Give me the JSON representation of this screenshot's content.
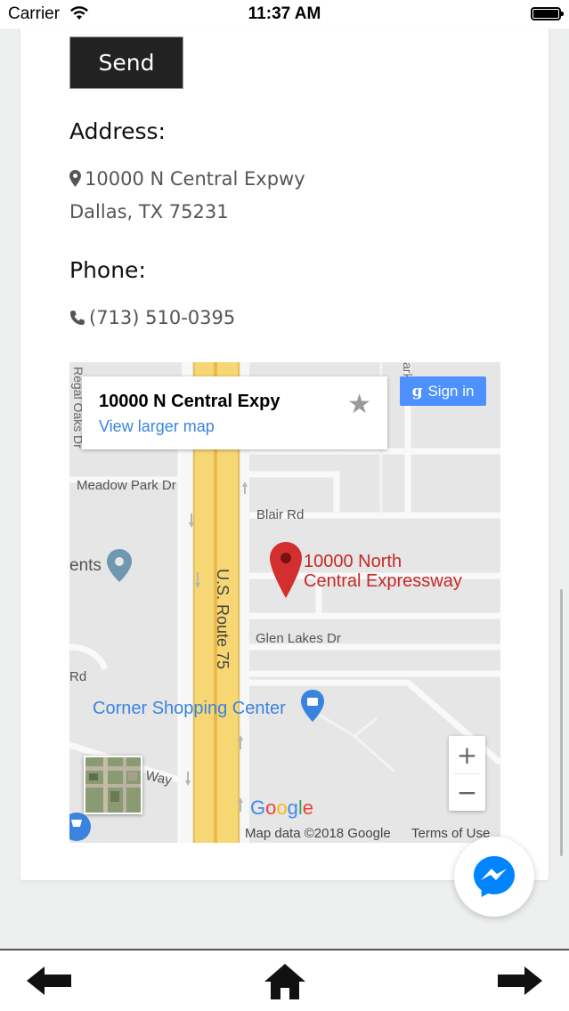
{
  "status_bar": {
    "carrier": "Carrier",
    "time": "11:37 AM"
  },
  "contact": {
    "send_label": "Send",
    "address_heading": "Address:",
    "address_line1": "10000 N Central Expwy",
    "address_line2": "Dallas, TX 75231",
    "phone_heading": "Phone:",
    "phone": "(713) 510-0395"
  },
  "map": {
    "place_title": "10000 N Central Expy",
    "view_larger": "View larger map",
    "sign_in": "Sign in",
    "marker_label_line1": "10000 North",
    "marker_label_line2": "Central Expressway",
    "streets": {
      "regal_oaks": "Regal Oaks Dr",
      "meadow_park": "Meadow Park Dr",
      "blair": "Blair Rd",
      "glen_lakes": "Glen Lakes Dr",
      "us_route": "U.S. Route 75",
      "rd": "Rd",
      "way": "l Way",
      "park_dr": "ark Dr",
      "ents": "ents"
    },
    "poi": "Corner Shopping Center",
    "google": "Google",
    "map_data": "Map data ©2018 Google",
    "terms": "Terms of Use",
    "zoom_in": "+",
    "zoom_out": "−",
    "colors": {
      "road_yellow": "#f7d774",
      "marker_red": "#d32f2f",
      "poi_blue": "#3a84df"
    }
  }
}
